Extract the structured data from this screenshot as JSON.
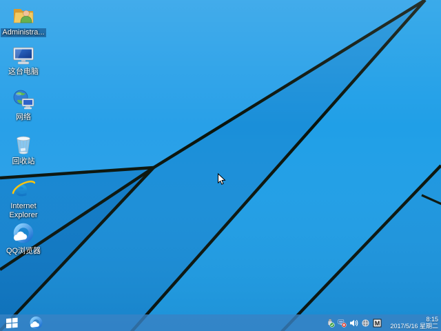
{
  "desktop": {
    "icons": [
      {
        "label": "Administra...",
        "icon": "user-folder-icon",
        "selected": true
      },
      {
        "label": "这台电脑",
        "icon": "this-pc-icon"
      },
      {
        "label": "网络",
        "icon": "network-globe-icon"
      },
      {
        "label": "回收站",
        "icon": "recycle-bin-icon"
      },
      {
        "label": "Internet Explorer",
        "icon": "internet-explorer-icon"
      },
      {
        "label": "QQ浏览器",
        "icon": "qq-browser-icon"
      }
    ]
  },
  "taskbar": {
    "start_button_icon": "windows-logo-icon",
    "pinned_icons": [
      "qq-browser-icon"
    ],
    "tray_icons": [
      "usb-safely-remove-icon",
      "network-disconnected-icon",
      "volume-icon",
      "language-indicator-icon",
      "input-method-icon"
    ],
    "input_indicator": "M",
    "clock": {
      "time": "8:15",
      "date": "2017/5/16 星期二"
    }
  },
  "colors": {
    "wallpaper_bright": "#28a0e8",
    "wallpaper_mid": "#1a8fd9",
    "wallpaper_dark": "#0f7ac6",
    "wallpaper_line": "#0a140c",
    "taskbar": "rgba(56,130,196,0.80)"
  }
}
